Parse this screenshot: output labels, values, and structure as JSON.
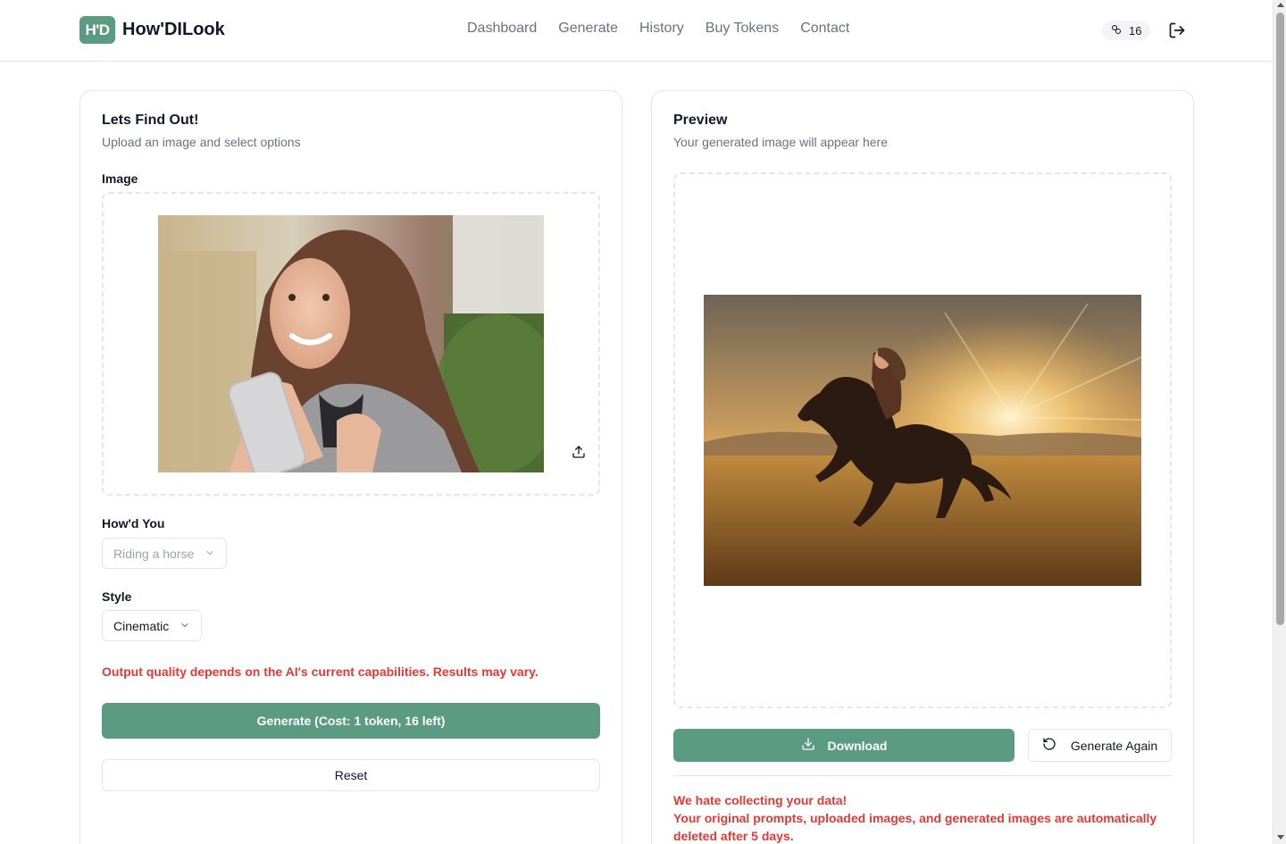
{
  "header": {
    "logo_text": "H'D",
    "brand": "How'DILook",
    "nav": [
      "Dashboard",
      "Generate",
      "History",
      "Buy Tokens",
      "Contact"
    ],
    "token_count": "16"
  },
  "left_card": {
    "title": "Lets Find Out!",
    "subtitle": "Upload an image and select options",
    "image_label": "Image",
    "howd_label": "How'd You",
    "howd_value": "Riding a horse",
    "style_label": "Style",
    "style_value": "Cinematic",
    "warning": "Output quality depends on the AI's current capabilities. Results may vary.",
    "generate_button": "Generate (Cost: 1 token, 16 left)",
    "reset_button": "Reset"
  },
  "right_card": {
    "title": "Preview",
    "subtitle": "Your generated image will appear here",
    "download_button": "Download",
    "again_button": "Generate Again",
    "privacy_line1": "We hate collecting your data!",
    "privacy_line2": "Your original prompts, uploaded images, and generated images are automatically deleted after 5 days."
  },
  "colors": {
    "accent": "#5a9b82",
    "warning": "#e53935"
  },
  "icons": [
    "link-icon",
    "logout-icon",
    "upload-icon",
    "chevron-down-icon",
    "download-icon",
    "refresh-icon"
  ]
}
